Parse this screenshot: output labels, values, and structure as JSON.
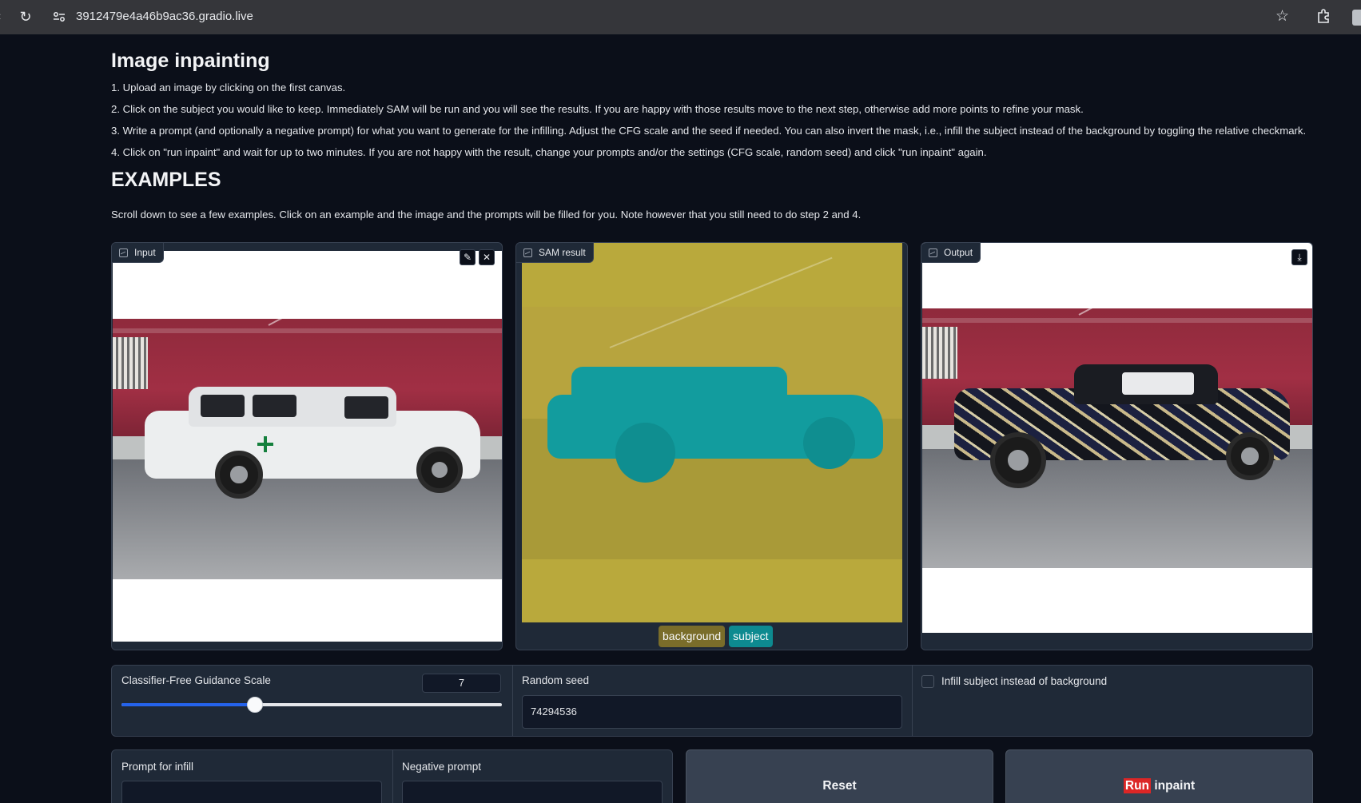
{
  "browser": {
    "url": "3912479e4a46b9ac36.gradio.live"
  },
  "page": {
    "title": "Image inpainting",
    "steps": [
      "1. Upload an image by clicking on the first canvas.",
      "2. Click on the subject you would like to keep. Immediately SAM will be run and you will see the results. If you are happy with those results move to the next step, otherwise add more points to refine your mask.",
      "3. Write a prompt (and optionally a negative prompt) for what you want to generate for the infilling. Adjust the CFG scale and the seed if needed. You can also invert the mask, i.e., infill the subject instead of the background by toggling the relative checkmark.",
      "4. Click on \"run inpaint\" and wait for up to two minutes. If you are not happy with the result, change your prompts and/or the settings (CFG scale, random seed) and click \"run inpaint\" again."
    ],
    "examples_heading": "EXAMPLES",
    "examples_note": "Scroll down to see a few examples. Click on an example and the image and the prompts will be filled for you. Note however that you still need to do step 2 and 4."
  },
  "panels": {
    "input": {
      "label": "Input",
      "icon": "image-icon"
    },
    "sam": {
      "label": "SAM result",
      "legend": [
        {
          "label": "background",
          "color": "#7a6d2a"
        },
        {
          "label": "subject",
          "color": "#0d8a90"
        }
      ],
      "mask_colors": {
        "background": "#b9a93c",
        "subject": "#129c9e"
      }
    },
    "output": {
      "label": "Output"
    }
  },
  "controls": {
    "cfg": {
      "label": "Classifier-Free Guidance Scale",
      "value": "7",
      "fraction": 0.35
    },
    "seed": {
      "label": "Random seed",
      "value": "74294536"
    },
    "invert": {
      "label": "Infill subject instead of background",
      "checked": false
    }
  },
  "prompts": {
    "infill_label": "Prompt for infill",
    "negative_label": "Negative prompt"
  },
  "buttons": {
    "reset": "Reset",
    "run_highlight": "Run",
    "run_rest": " inpaint"
  },
  "colors": {
    "background": "#0b0f19",
    "panel": "#1f2937",
    "slider_fill": "#2563eb",
    "highlight": "#dc2626"
  }
}
